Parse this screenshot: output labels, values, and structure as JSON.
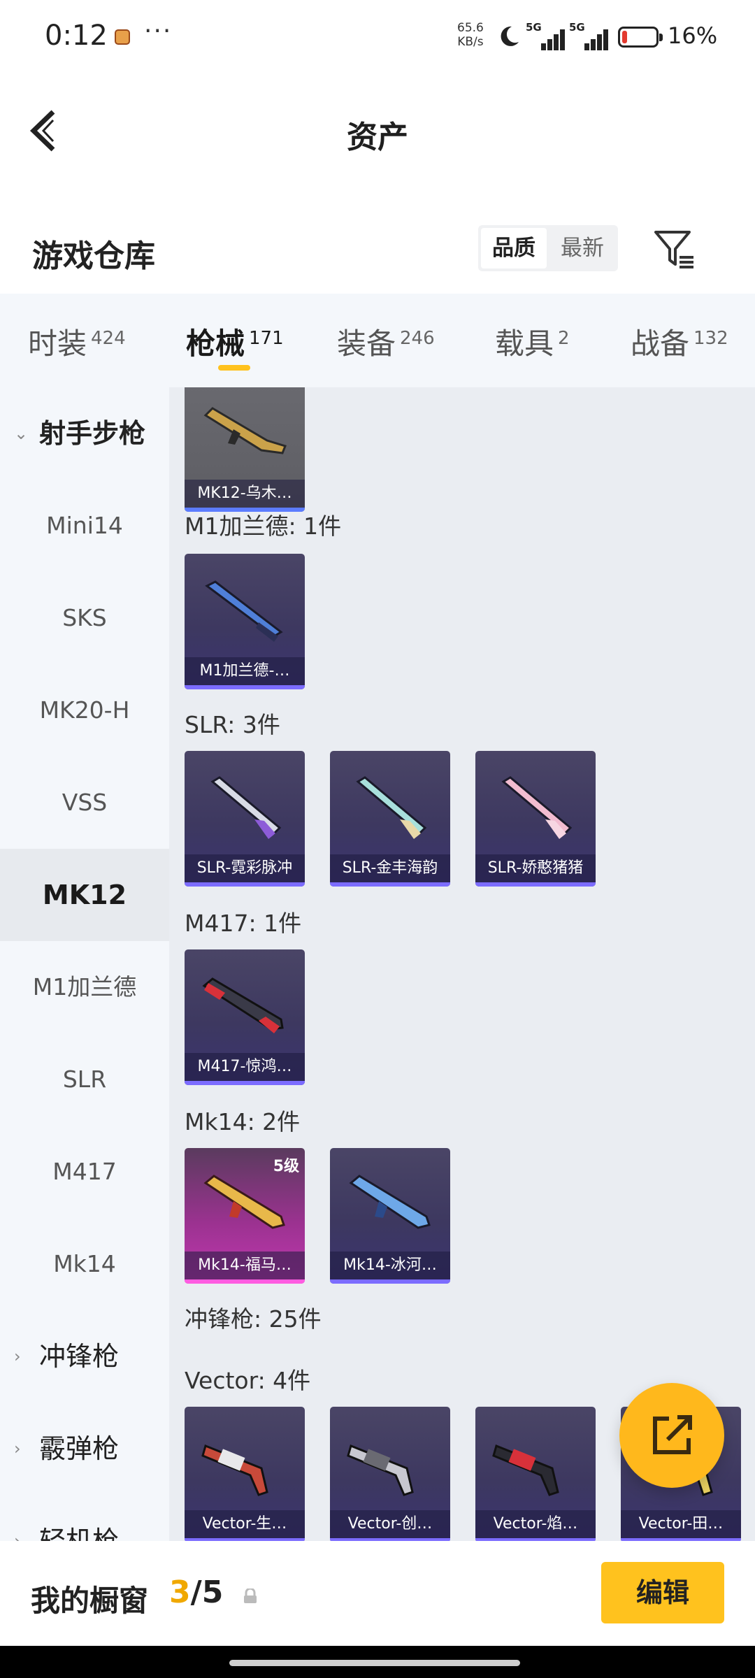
{
  "status_bar": {
    "time": "0:12",
    "speed_value": "65.6",
    "speed_unit": "KB/s",
    "sim1": "5G",
    "sim2": "5G",
    "battery_percent": "16%",
    "battery_level": 0.16,
    "battery_color": "#e33a2f"
  },
  "header": {
    "title": "资产"
  },
  "warehouse": {
    "title": "游戏仓库",
    "sort_options": [
      "品质",
      "最新"
    ],
    "sort_selected": "品质"
  },
  "tabs": [
    {
      "label": "时装",
      "count": "424"
    },
    {
      "label": "枪械",
      "count": "171",
      "active": true
    },
    {
      "label": "装备",
      "count": "246"
    },
    {
      "label": "载具",
      "count": "2"
    },
    {
      "label": "战备",
      "count": "132"
    }
  ],
  "sidebar": {
    "group_open": "射手步枪",
    "items": [
      "Mini14",
      "SKS",
      "MK20-H",
      "VSS",
      "MK12",
      "M1加兰德",
      "SLR",
      "M417",
      "Mk14"
    ],
    "active_item": "MK12",
    "groups_closed": [
      "冲锋枪",
      "霰弹枪",
      "轻机枪"
    ]
  },
  "content": {
    "top_card": {
      "label": "MK12-乌木…"
    },
    "m1_head": "M1加兰德: 1件",
    "m1_cards": [
      "M1加兰德-…"
    ],
    "slr_head": "SLR: 3件",
    "slr_cards": [
      "SLR-霓彩脉冲",
      "SLR-金丰海韵",
      "SLR-娇憨猪猪"
    ],
    "m417_head": "M417: 1件",
    "m417_cards": [
      "M417-惊鸿…"
    ],
    "mk14_head": "Mk14: 2件",
    "mk14_cards": [
      "Mk14-福马…",
      "Mk14-冰河…"
    ],
    "mk14_level": "5级",
    "smg_head": "冲锋枪: 25件",
    "vector_head": "Vector: 4件",
    "vector_cards": [
      "Vector-生…",
      "Vector-创…",
      "Vector-焰…",
      "Vector-田…"
    ]
  },
  "bottom_bar": {
    "label": "我的橱窗",
    "current": "3",
    "separator": "/",
    "total": "5",
    "edit_label": "编辑"
  },
  "colors": {
    "accent": "#ffc21e",
    "rare_card": "#3d3860",
    "legendary_card": "#c138b0"
  }
}
